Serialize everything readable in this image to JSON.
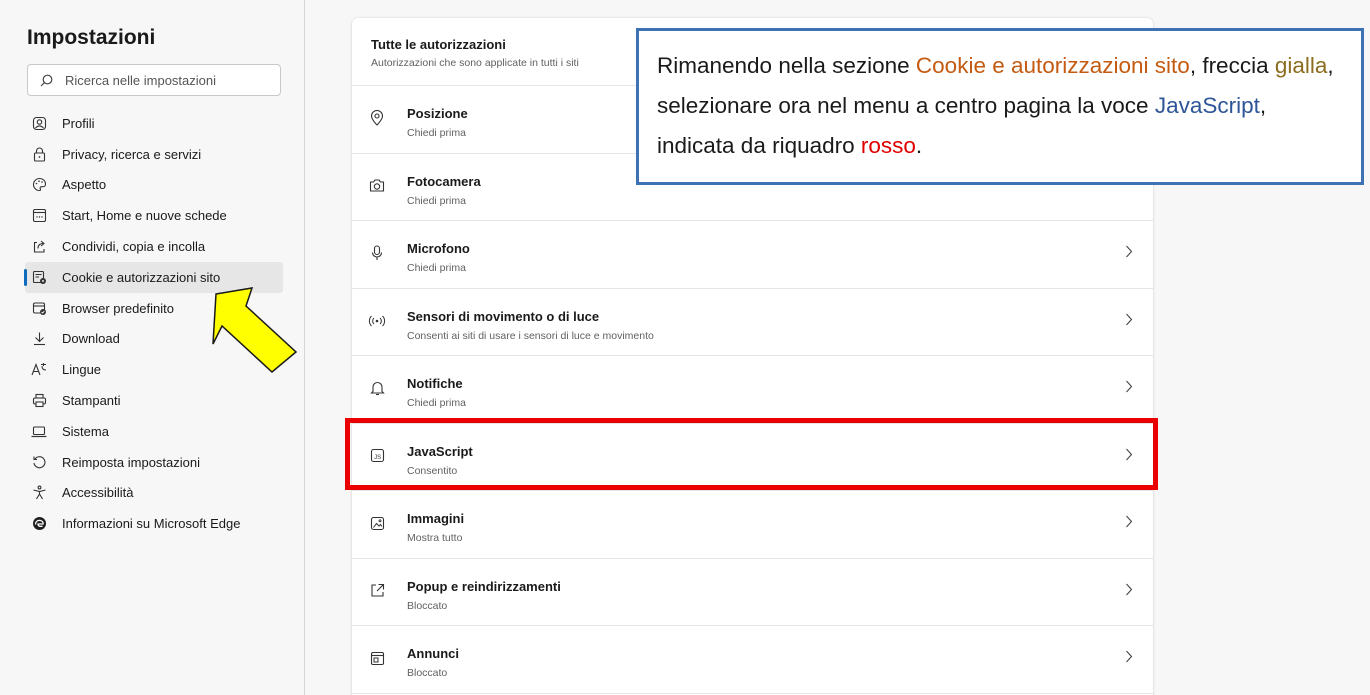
{
  "sidebar": {
    "title": "Impostazioni",
    "search_placeholder": "Ricerca nelle impostazioni",
    "items": [
      {
        "label": "Profili",
        "icon": "profile-icon"
      },
      {
        "label": "Privacy, ricerca e servizi",
        "icon": "lock-icon"
      },
      {
        "label": "Aspetto",
        "icon": "palette-icon"
      },
      {
        "label": "Start, Home e nuove schede",
        "icon": "home-tab-icon"
      },
      {
        "label": "Condividi, copia e incolla",
        "icon": "share-icon"
      },
      {
        "label": "Cookie e autorizzazioni sito",
        "icon": "cookie-settings-icon",
        "active": true
      },
      {
        "label": "Browser predefinito",
        "icon": "default-browser-icon"
      },
      {
        "label": "Download",
        "icon": "download-icon"
      },
      {
        "label": "Lingue",
        "icon": "language-icon"
      },
      {
        "label": "Stampanti",
        "icon": "printer-icon"
      },
      {
        "label": "Sistema",
        "icon": "laptop-icon"
      },
      {
        "label": "Reimposta impostazioni",
        "icon": "reset-icon"
      },
      {
        "label": "Accessibilità",
        "icon": "accessibility-icon"
      },
      {
        "label": "Informazioni su Microsoft Edge",
        "icon": "edge-logo-icon"
      }
    ]
  },
  "main": {
    "header_title": "Tutte le autorizzazioni",
    "header_subtitle": "Autorizzazioni che sono applicate in tutti i siti",
    "rows": [
      {
        "title": "Posizione",
        "subtitle": "Chiedi prima",
        "icon": "location-icon"
      },
      {
        "title": "Fotocamera",
        "subtitle": "Chiedi prima",
        "icon": "camera-icon"
      },
      {
        "title": "Microfono",
        "subtitle": "Chiedi prima",
        "icon": "microphone-icon"
      },
      {
        "title": "Sensori di movimento o di luce",
        "subtitle": "Consenti ai siti di usare i sensori di luce e movimento",
        "icon": "sensor-icon"
      },
      {
        "title": "Notifiche",
        "subtitle": "Chiedi prima",
        "icon": "bell-icon"
      },
      {
        "title": "JavaScript",
        "subtitle": "Consentito",
        "icon": "javascript-icon"
      },
      {
        "title": "Immagini",
        "subtitle": "Mostra tutto",
        "icon": "image-icon"
      },
      {
        "title": "Popup e reindirizzamenti",
        "subtitle": "Bloccato",
        "icon": "popup-icon"
      },
      {
        "title": "Annunci",
        "subtitle": "Bloccato",
        "icon": "ads-icon"
      }
    ]
  },
  "callout": {
    "p1": "Rimanendo nella sezione ",
    "p2": "Cookie e autorizzazioni sito",
    "p3": ", freccia ",
    "p4": "gialla",
    "p5": ", selezionare ora nel menu a centro pagina la voce ",
    "p6": "JavaScript",
    "p7": ", indicata da riquadro ",
    "p8": "rosso",
    "p9": "."
  },
  "colors": {
    "accent": "#0f6cbd",
    "callout_border": "#3d72b4",
    "highlight_red": "#ea0000",
    "arrow_yellow": "#ffff00"
  }
}
